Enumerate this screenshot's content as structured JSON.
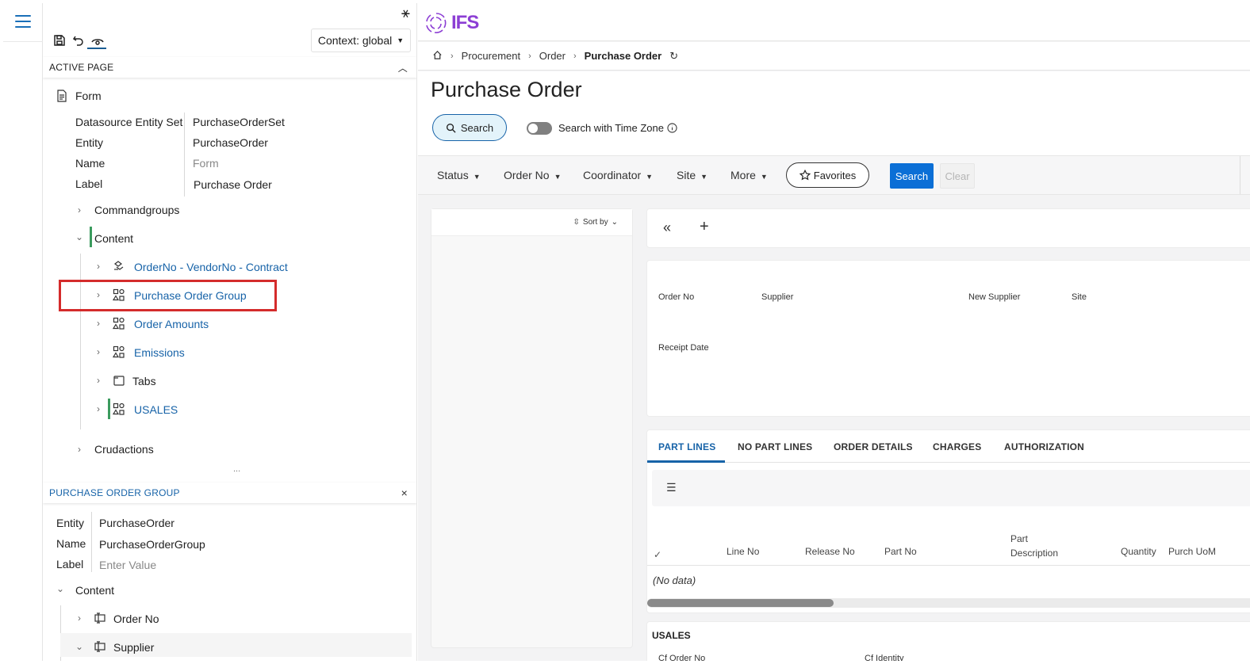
{
  "designer": {
    "context_label": "Context: global",
    "active_page_title": "ACTIVE PAGE",
    "form_label": "Form",
    "props": [
      {
        "key": "Datasource Entity Set",
        "value": "PurchaseOrderSet"
      },
      {
        "key": "Entity",
        "value": "PurchaseOrder"
      },
      {
        "key": "Name",
        "value": "Form"
      },
      {
        "key": "Label",
        "value": "Purchase Order"
      }
    ],
    "commandgroups": "Commandgroups",
    "content": "Content",
    "content_items": [
      {
        "label": "OrderNo - VendorNo - Contract"
      },
      {
        "label": "Purchase Order Group"
      },
      {
        "label": "Order Amounts"
      },
      {
        "label": "Emissions"
      },
      {
        "label": "Tabs"
      },
      {
        "label": "USALES"
      }
    ],
    "crudactions": "Crudactions",
    "ellipsis": "...",
    "group_title": "PURCHASE ORDER GROUP",
    "group_props": [
      {
        "key": "Entity",
        "value": "PurchaseOrder"
      },
      {
        "key": "Name",
        "value": "PurchaseOrderGroup"
      },
      {
        "key": "Label",
        "value": "Enter Value"
      }
    ],
    "group_content": "Content",
    "group_items": [
      {
        "label": "Order No"
      },
      {
        "label": "Supplier"
      }
    ]
  },
  "main": {
    "logo_text": "IFS",
    "breadcrumb": [
      "Procurement",
      "Order",
      "Purchase Order"
    ],
    "title": "Purchase Order",
    "search_button": "Search",
    "timezone_label": "Search with Time Zone",
    "filters": [
      "Status",
      "Order No",
      "Coordinator",
      "Site",
      "More"
    ],
    "favorites": "Favorites",
    "search": "Search",
    "clear": "Clear",
    "sort_by": "Sort by",
    "fields_row1": [
      "Order No",
      "Supplier",
      "New Supplier",
      "Site"
    ],
    "fields_row2": [
      "Receipt Date"
    ],
    "tabs": [
      "PART LINES",
      "NO PART LINES",
      "ORDER DETAILS",
      "CHARGES",
      "AUTHORIZATION"
    ],
    "columns": [
      "Line No",
      "Release No",
      "Part No",
      "Part Description",
      "Quantity",
      "Purch UoM"
    ],
    "no_data": "(No data)",
    "usales_title": "USALES",
    "usales_cols": [
      "Cf Order No",
      "Cf Identity"
    ]
  },
  "colors": {
    "accent": "#1763a8",
    "primary_button": "#0b6fd6",
    "highlight": "#d42b2b",
    "brand": "#8c3ed4"
  }
}
